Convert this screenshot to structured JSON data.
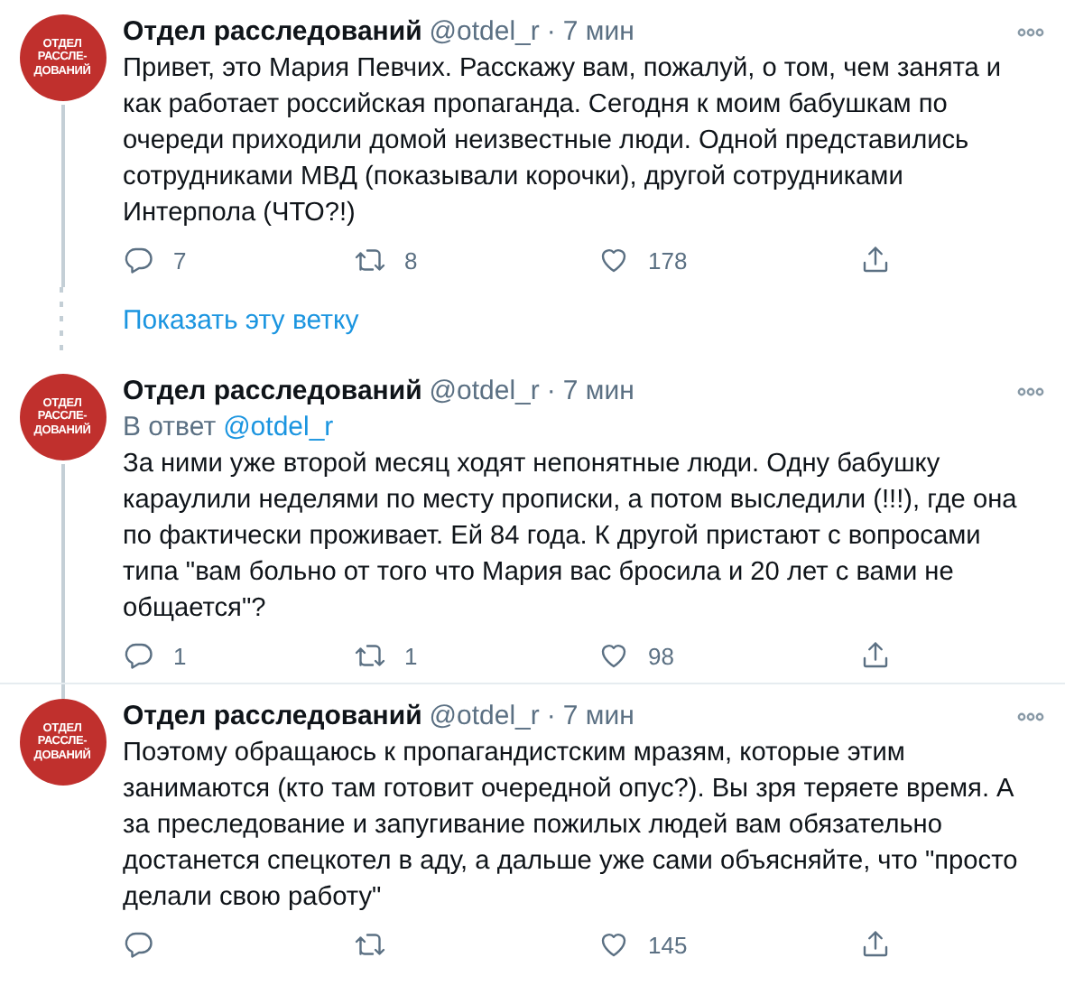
{
  "feed": [
    {
      "kind": "tweet",
      "avatar": {
        "lines": [
          "ОТДЕЛ",
          "РАССЛЕ-",
          "ДОВАНИЙ"
        ]
      },
      "author": "Отдел расследований",
      "handle": "@otdel_r",
      "dot": "·",
      "time": "7 мин",
      "text": "Привет, это Мария Певчих. Расскажу вам, пожалуй, о том, чем занята и как работает российская пропаганда. Сегодня к моим бабушкам по очереди приходили домой неизвестные люди. Одной представились сотрудниками МВД (показывали корочки), другой сотрудниками Интерпола (ЧТО?!)",
      "replies": "7",
      "retweets": "8",
      "likes": "178",
      "thread_above": false,
      "thread_below": true
    },
    {
      "kind": "show_thread",
      "label": "Показать эту ветку"
    },
    {
      "kind": "tweet",
      "avatar": {
        "lines": [
          "ОТДЕЛ",
          "РАССЛЕ-",
          "ДОВАНИЙ"
        ]
      },
      "author": "Отдел расследований",
      "handle": "@otdel_r",
      "dot": "·",
      "time": "7 мин",
      "reply_to": {
        "prefix": "В ответ",
        "handle": "@otdel_r"
      },
      "text": "За ними уже второй месяц ходят непонятные люди. Одну бабушку караулили неделями по месту прописки, а потом выследили (!!!), где она по фактически проживает. Ей 84 года. К другой пристают с вопросами типа \"вам больно от того что Мария вас бросила и 20 лет с вами не общается\"?",
      "replies": "1",
      "retweets": "1",
      "likes": "98",
      "thread_above": false,
      "thread_below": true
    },
    {
      "kind": "tweet",
      "avatar": {
        "lines": [
          "ОТДЕЛ",
          "РАССЛЕ-",
          "ДОВАНИЙ"
        ]
      },
      "author": "Отдел расследований",
      "handle": "@otdel_r",
      "dot": "·",
      "time": "7 мин",
      "text": "Поэтому обращаюсь к пропагандистским мразям, которые этим занимаются (кто там готовит очередной опус?). Вы зря теряете время. А за преследование и запугивание пожилых людей вам обязательно достанется спецкотел в аду, а дальше уже сами объясняйте, что \"просто делали свою работу\"",
      "likes": "145",
      "thread_above": true,
      "thread_below": false
    }
  ]
}
